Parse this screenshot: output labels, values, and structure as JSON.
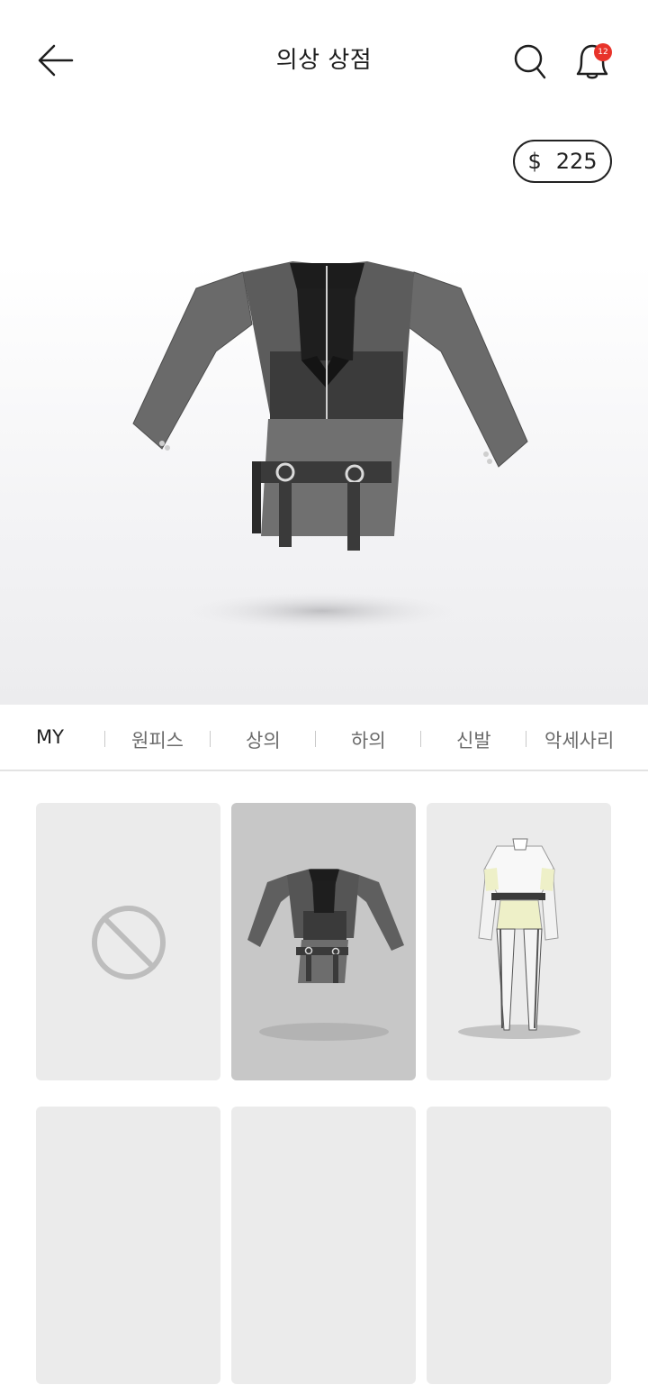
{
  "header": {
    "title": "의상 상점",
    "notification_count": "12"
  },
  "wallet": {
    "currency_symbol": "$",
    "balance": "225"
  },
  "tabs": [
    {
      "label": "MY",
      "active": true
    },
    {
      "label": "원피스",
      "active": false
    },
    {
      "label": "상의",
      "active": false
    },
    {
      "label": "하의",
      "active": false
    },
    {
      "label": "신발",
      "active": false
    },
    {
      "label": "악세사리",
      "active": false
    }
  ],
  "grid": {
    "items": [
      {
        "type": "none-icon"
      },
      {
        "type": "outfit-dark-dress",
        "selected": true
      },
      {
        "type": "outfit-white-set"
      },
      {
        "type": "empty"
      },
      {
        "type": "empty"
      },
      {
        "type": "empty"
      }
    ]
  },
  "colors": {
    "badge": "#e8332a",
    "selected_card": "#c7c7c7",
    "card": "#ebebeb"
  }
}
